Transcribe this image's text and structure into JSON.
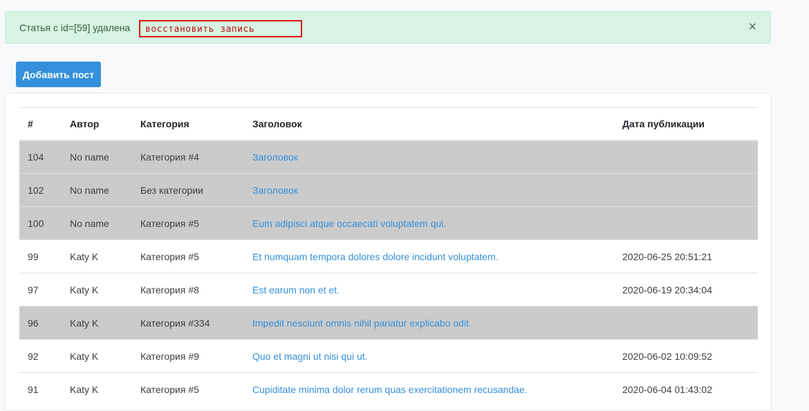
{
  "alert": {
    "message": "Статья с id=[59] удалена",
    "restore_link": "восстановить запись",
    "close": "×"
  },
  "actions": {
    "add_post": "Добавить пост"
  },
  "table": {
    "columns": [
      "#",
      "Автор",
      "Категория",
      "Заголовок",
      "Дата публикации"
    ],
    "rows": [
      {
        "id": "104",
        "author": "No name",
        "category": "Категория #4",
        "title": "Заголовок",
        "date": "",
        "deleted": true
      },
      {
        "id": "102",
        "author": "No name",
        "category": "Без категории",
        "title": "Заголовок",
        "date": "",
        "deleted": true
      },
      {
        "id": "100",
        "author": "No name",
        "category": "Категория #5",
        "title": "Eum adipisci atque occaecati voluptatem qui.",
        "date": "",
        "deleted": true
      },
      {
        "id": "99",
        "author": "Katy K",
        "category": "Категория #5",
        "title": "Et numquam tempora dolores dolore incidunt voluptatem.",
        "date": "2020-06-25 20:51:21",
        "deleted": false
      },
      {
        "id": "97",
        "author": "Katy K",
        "category": "Категория #8",
        "title": "Est earum non et et.",
        "date": "2020-06-19 20:34:04",
        "deleted": false
      },
      {
        "id": "96",
        "author": "Katy K",
        "category": "Категория #334",
        "title": "Impedit nesciunt omnis nihil pariatur explicabo odit.",
        "date": "",
        "deleted": true
      },
      {
        "id": "92",
        "author": "Katy K",
        "category": "Категория #9",
        "title": "Quo et magni ut nisi qui ut.",
        "date": "2020-06-02 10:09:52",
        "deleted": false
      },
      {
        "id": "91",
        "author": "Katy K",
        "category": "Категория #5",
        "title": "Cupiditate minima dolor rerum quas exercitationem recusandae.",
        "date": "2020-06-04 01:43:02",
        "deleted": false
      }
    ]
  }
}
